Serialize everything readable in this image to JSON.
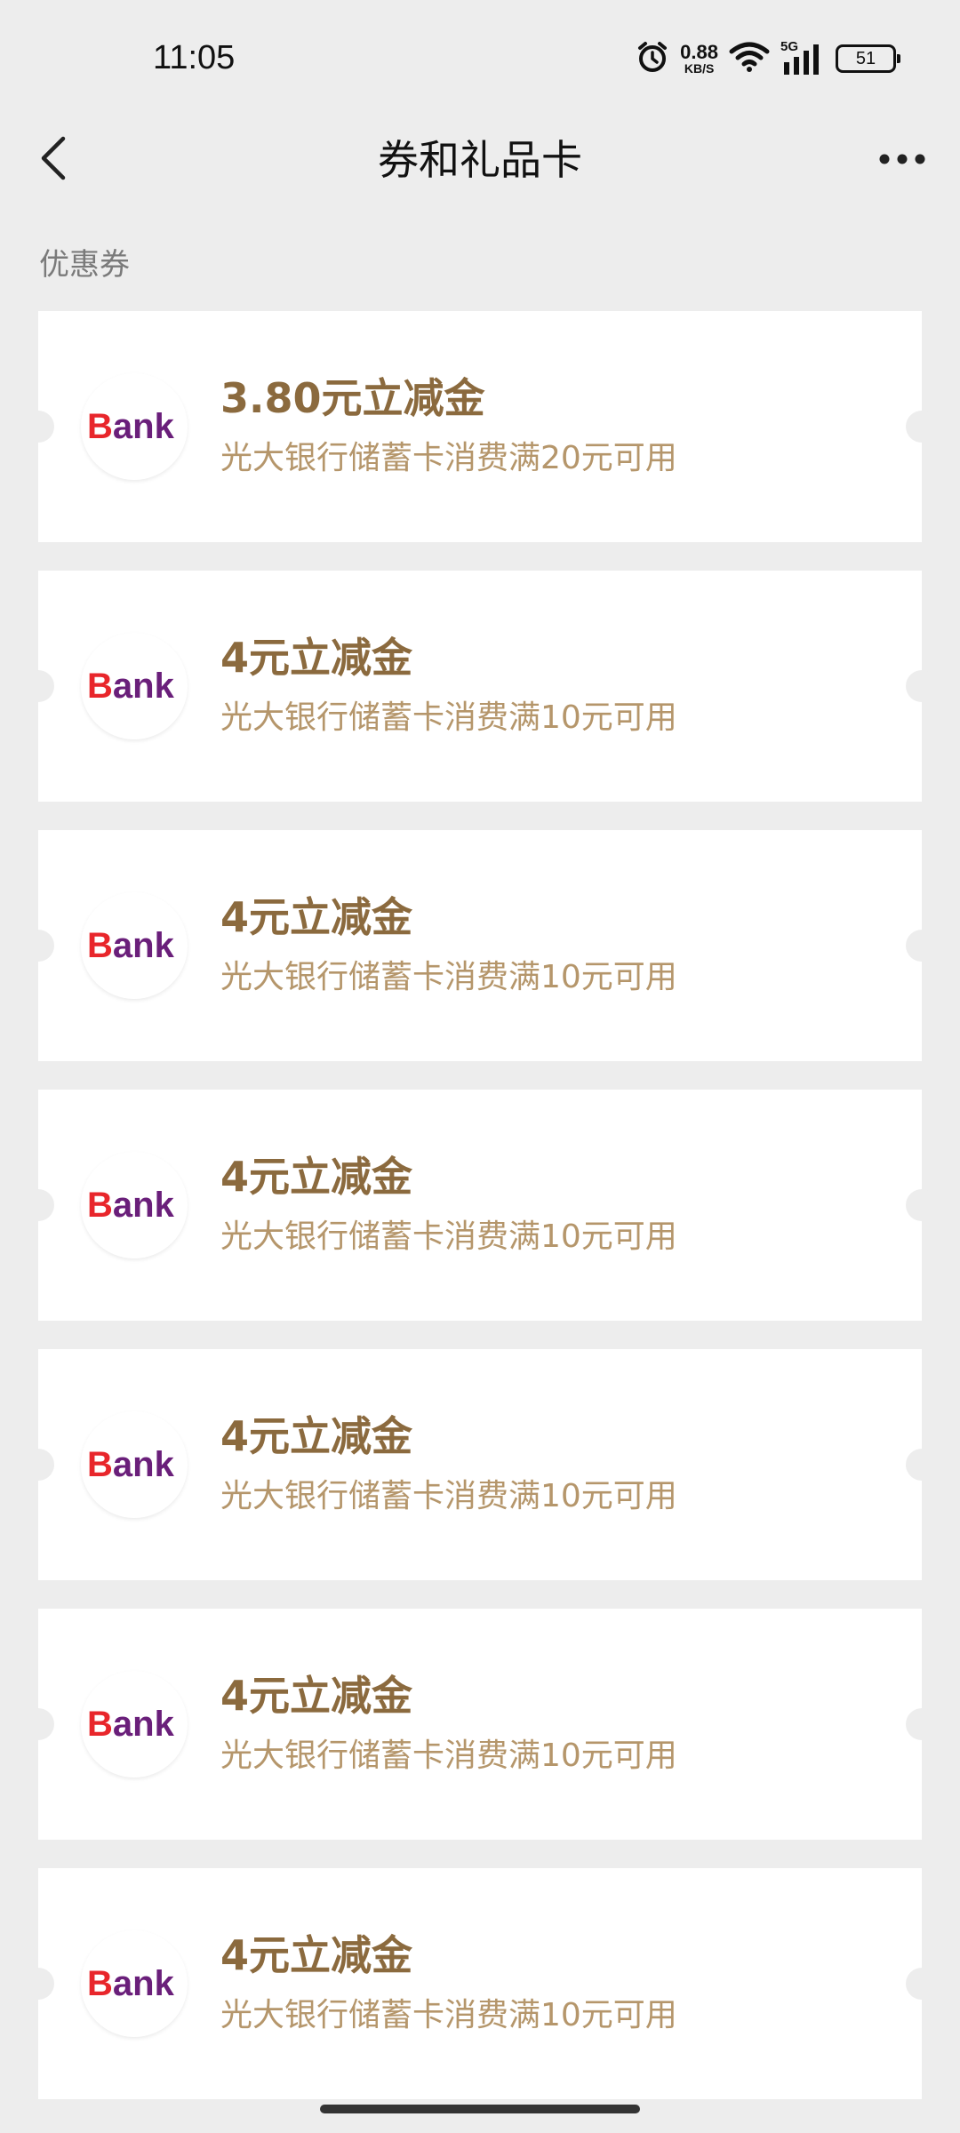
{
  "status_bar": {
    "time": "11:05",
    "net_speed_value": "0.88",
    "net_speed_unit": "KB/S",
    "network_type": "5G",
    "battery": "51",
    "icons": [
      "alarm-icon",
      "wifi-icon",
      "signal-icon",
      "battery-icon"
    ]
  },
  "nav": {
    "title": "券和礼品卡",
    "back_icon": "chevron-left-icon",
    "more_icon": "more-icon"
  },
  "section": {
    "title": "优惠券"
  },
  "coupons": [
    {
      "logo_text": "Bank",
      "title": "3.80元立减金",
      "desc": "光大银行储蓄卡消费满20元可用"
    },
    {
      "logo_text": "Bank",
      "title": "4元立减金",
      "desc": "光大银行储蓄卡消费满10元可用"
    },
    {
      "logo_text": "Bank",
      "title": "4元立减金",
      "desc": "光大银行储蓄卡消费满10元可用"
    },
    {
      "logo_text": "Bank",
      "title": "4元立减金",
      "desc": "光大银行储蓄卡消费满10元可用"
    },
    {
      "logo_text": "Bank",
      "title": "4元立减金",
      "desc": "光大银行储蓄卡消费满10元可用"
    },
    {
      "logo_text": "Bank",
      "title": "4元立减金",
      "desc": "光大银行储蓄卡消费满10元可用"
    },
    {
      "logo_text": "Bank",
      "title": "4元立减金",
      "desc": "光大银行储蓄卡消费满10元可用"
    }
  ],
  "colors": {
    "background": "#ededed",
    "coupon_title": "#8b6a3e",
    "coupon_desc": "#b5966b",
    "logo_red": "#e8262b",
    "logo_purple": "#6a1f7a"
  }
}
